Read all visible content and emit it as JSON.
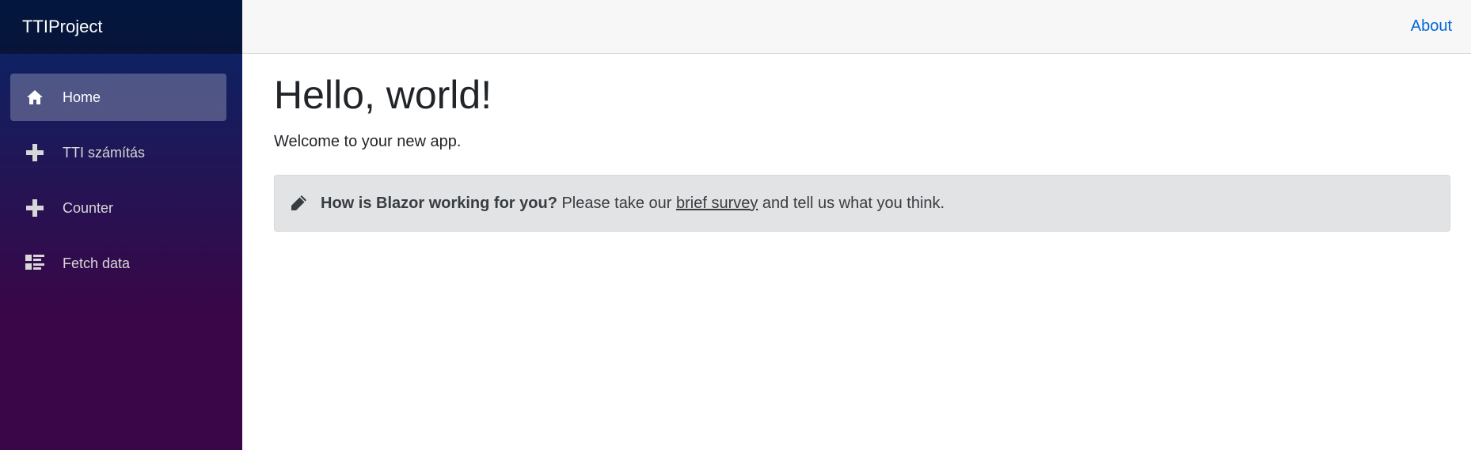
{
  "brand": "TTIProject",
  "nav": {
    "items": [
      {
        "label": "Home",
        "icon": "home-icon",
        "active": true
      },
      {
        "label": "TTI számítás",
        "icon": "plus-icon",
        "active": false
      },
      {
        "label": "Counter",
        "icon": "plus-icon",
        "active": false
      },
      {
        "label": "Fetch data",
        "icon": "list-rich-icon",
        "active": false
      }
    ]
  },
  "top_row": {
    "about_label": "About"
  },
  "main": {
    "title": "Hello, world!",
    "welcome": "Welcome to your new app.",
    "survey": {
      "question": "How is Blazor working for you?",
      "text_before": " Please take our ",
      "link_label": "brief survey",
      "text_after": " and tell us what you think."
    }
  },
  "colors": {
    "sidebar_gradient_top": "#052767",
    "sidebar_gradient_bottom": "#3a0647",
    "link": "#0366d6",
    "alert_bg": "#e2e3e5"
  }
}
